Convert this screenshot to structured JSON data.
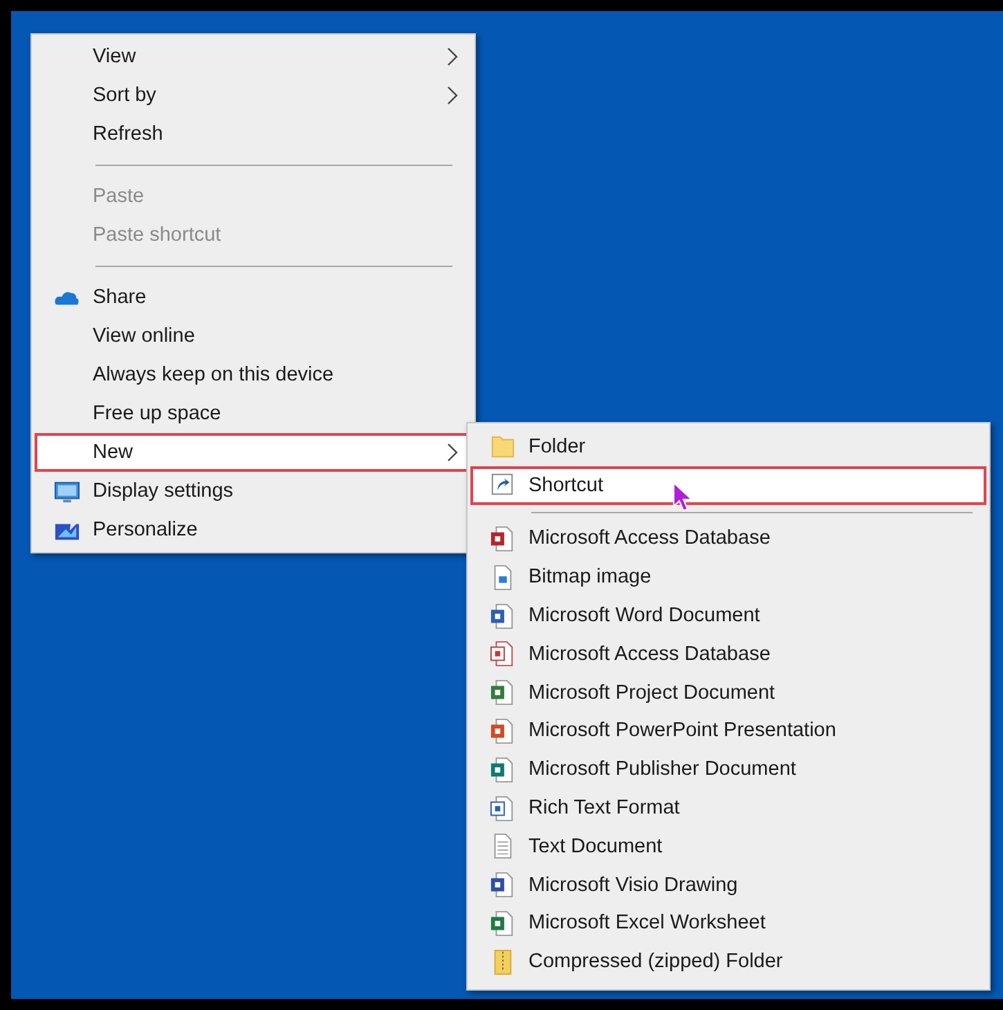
{
  "context_menu": {
    "items": [
      {
        "kind": "item",
        "label": "View",
        "submenu": true,
        "disabled": false,
        "selected": false
      },
      {
        "kind": "item",
        "label": "Sort by",
        "submenu": true,
        "disabled": false,
        "selected": false
      },
      {
        "kind": "item",
        "label": "Refresh",
        "submenu": false,
        "disabled": false,
        "selected": false
      },
      {
        "kind": "separator"
      },
      {
        "kind": "item",
        "label": "Paste",
        "submenu": false,
        "disabled": true,
        "selected": false
      },
      {
        "kind": "item",
        "label": "Paste shortcut",
        "submenu": false,
        "disabled": true,
        "selected": false
      },
      {
        "kind": "separator"
      },
      {
        "kind": "cloud",
        "label": "Share",
        "submenu": false,
        "disabled": false,
        "selected": false
      },
      {
        "kind": "item",
        "label": "View online",
        "submenu": false,
        "disabled": false,
        "selected": false
      },
      {
        "kind": "item",
        "label": "Always keep on this device",
        "submenu": false,
        "disabled": false,
        "selected": false
      },
      {
        "kind": "item",
        "label": "Free up space",
        "submenu": false,
        "disabled": false,
        "selected": false
      },
      {
        "kind": "item",
        "label": "New",
        "submenu": true,
        "disabled": false,
        "selected": true
      },
      {
        "kind": "monitor",
        "label": "Display settings",
        "submenu": false,
        "disabled": false,
        "selected": false
      },
      {
        "kind": "personalize",
        "label": "Personalize",
        "submenu": false,
        "disabled": false,
        "selected": false
      }
    ]
  },
  "new_submenu": {
    "items": [
      {
        "kind": "folder",
        "label": "Folder",
        "selected": false
      },
      {
        "kind": "shortcut",
        "label": "Shortcut",
        "selected": true
      },
      {
        "kind": "separator"
      },
      {
        "kind": "access",
        "label": "Microsoft Access Database",
        "selected": false
      },
      {
        "kind": "bitmap",
        "label": "Bitmap image",
        "selected": false
      },
      {
        "kind": "word",
        "label": "Microsoft Word Document",
        "selected": false
      },
      {
        "kind": "outline",
        "label": "Microsoft Access Database",
        "selected": false
      },
      {
        "kind": "project",
        "label": "Microsoft Project Document",
        "selected": false
      },
      {
        "kind": "powerpoint",
        "label": "Microsoft PowerPoint Presentation",
        "selected": false
      },
      {
        "kind": "publisher",
        "label": "Microsoft Publisher Document",
        "selected": false
      },
      {
        "kind": "rtf",
        "label": "Rich Text Format",
        "selected": false
      },
      {
        "kind": "text",
        "label": "Text Document",
        "selected": false
      },
      {
        "kind": "visio",
        "label": "Microsoft Visio Drawing",
        "selected": false
      },
      {
        "kind": "excel",
        "label": "Microsoft Excel Worksheet",
        "selected": false
      },
      {
        "kind": "zip",
        "label": "Compressed (zipped) Folder",
        "selected": false
      }
    ]
  }
}
